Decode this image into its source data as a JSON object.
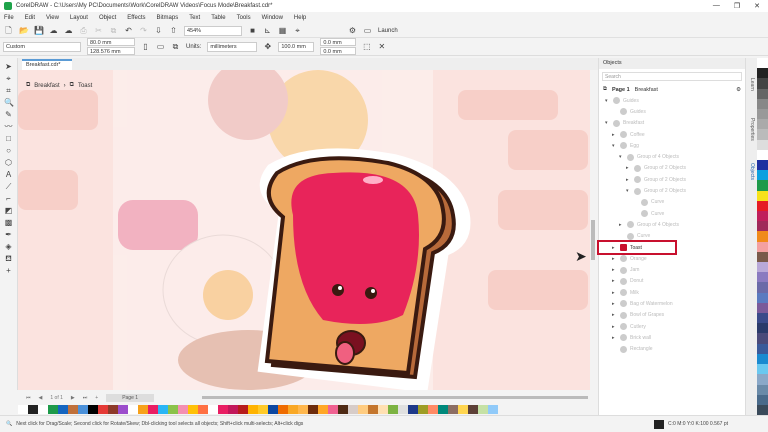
{
  "window": {
    "title": "CorelDRAW - C:\\Users\\My PC\\Documents\\Work\\CorelDRAW Videos\\Focus Mode\\Breakfast.cdr*",
    "controls": [
      "—",
      "❐",
      "✕"
    ]
  },
  "menu": [
    "File",
    "Edit",
    "View",
    "Layout",
    "Object",
    "Effects",
    "Bitmaps",
    "Text",
    "Table",
    "Tools",
    "Window",
    "Help"
  ],
  "toolbar": {
    "zoom": "454%",
    "launch": "Launch"
  },
  "propbar": {
    "page_size": "Custom",
    "width": "80.0 mm",
    "height": "128.576 mm",
    "units_label": "Units:",
    "units": "millimeters",
    "nudge": "100.0 mm",
    "dup_x": "0.0 mm",
    "dup_y": "0.0 mm"
  },
  "document_tab": "Breakfast.cdr*",
  "breadcrumb": [
    "Breakfast",
    "Toast"
  ],
  "page_nav": {
    "counter": "1 of 1",
    "page_tab": "Page 1"
  },
  "objects_panel": {
    "title": "Objects",
    "search_placeholder": "Search",
    "page": "Page 1",
    "layer": "Breakfast",
    "tree": [
      {
        "label": "Guides",
        "indent": 0,
        "arrow": "▾"
      },
      {
        "label": "Guides",
        "indent": 1,
        "arrow": ""
      },
      {
        "label": "Breakfast",
        "indent": 0,
        "arrow": "▾"
      },
      {
        "label": "Coffee",
        "indent": 1,
        "arrow": "▸"
      },
      {
        "label": "Egg",
        "indent": 1,
        "arrow": "▾"
      },
      {
        "label": "Group of 4 Objects",
        "indent": 2,
        "arrow": "▾"
      },
      {
        "label": "Group of 2 Objects",
        "indent": 3,
        "arrow": "▸"
      },
      {
        "label": "Group of 2 Objects",
        "indent": 3,
        "arrow": "▸"
      },
      {
        "label": "Group of 2 Objects",
        "indent": 3,
        "arrow": "▾"
      },
      {
        "label": "Curve",
        "indent": 4,
        "arrow": ""
      },
      {
        "label": "Curve",
        "indent": 4,
        "arrow": ""
      },
      {
        "label": "Group of 4 Objects",
        "indent": 2,
        "arrow": "▸"
      },
      {
        "label": "Curve",
        "indent": 2,
        "arrow": ""
      },
      {
        "label": "Toast",
        "indent": 1,
        "arrow": "▸",
        "highlight": true
      },
      {
        "label": "Orange",
        "indent": 1,
        "arrow": "▸"
      },
      {
        "label": "Jam",
        "indent": 1,
        "arrow": "▸"
      },
      {
        "label": "Donut",
        "indent": 1,
        "arrow": "▸"
      },
      {
        "label": "Milk",
        "indent": 1,
        "arrow": "▸"
      },
      {
        "label": "Bag of Watermelon",
        "indent": 1,
        "arrow": "▸"
      },
      {
        "label": "Bowl of Grapes",
        "indent": 1,
        "arrow": "▸"
      },
      {
        "label": "Cutlery",
        "indent": 1,
        "arrow": "▸"
      },
      {
        "label": "Brick wall",
        "indent": 1,
        "arrow": "▸"
      },
      {
        "label": "Rectangle",
        "indent": 1,
        "arrow": ""
      }
    ]
  },
  "dock_tabs": [
    "Learn",
    "Properties",
    "Objects"
  ],
  "status": {
    "hint": "Next click for Drag/Scale; Second click for Rotate/Skew; Dbl-clicking tool selects all objects; Shift+click multi-selects; Alt+click digs",
    "fill": "C:0 M:0 Y:0 K:100 0.567 pt"
  },
  "colors": {
    "accent": "#5b9bd5",
    "highlight": "#c8102e",
    "toast": "#e8a05a",
    "jam": "#e8245a"
  },
  "palette_h": [
    "#ffffff",
    "#222222",
    "#ffffff",
    "#1e9a4a",
    "#1565c0",
    "#c0703a",
    "#4a90d9",
    "#000000",
    "#e53935",
    "#8e3a2a",
    "#9c4dcc",
    "#ffffff",
    "#f7a11a",
    "#e91e63",
    "#29b6f6",
    "#8bc34a",
    "#f48fb1",
    "#ffc107",
    "#ff7043",
    "#ffffff",
    "#e91e63",
    "#c2185b",
    "#b71c1c",
    "#ffb300",
    "#ffca28",
    "#0d47a1",
    "#ef6c00",
    "#f9a825",
    "#ffb74d",
    "#6d2c0c",
    "#ffa726",
    "#f06292",
    "#4e2a14",
    "#d7ccc8",
    "#ffcc80",
    "#c4762d",
    "#ffe0b2",
    "#7cb342",
    "#e0e0e0",
    "#1e3a8a",
    "#9e9d24",
    "#ff8a65",
    "#00897b",
    "#8d6e63",
    "#ffd54f",
    "#5d4037",
    "#c5e1a5",
    "#90caf9"
  ],
  "palette_v": [
    "#ffffff",
    "#222",
    "#444",
    "#666",
    "#888",
    "#999",
    "#aaa",
    "#bbb",
    "#ddd",
    "#fff",
    "#1e2fa0",
    "#0aa0e0",
    "#1e9a4a",
    "#f7e21a",
    "#e51b24",
    "#c01f5b",
    "#a0295a",
    "#f08a1a",
    "#f4a0a0",
    "#7a5a4a",
    "#b8a8d8",
    "#8a7ac0",
    "#6a6aa8",
    "#5a7ac0",
    "#7a5a9a",
    "#3a4a8a",
    "#2a3a6a",
    "#4a4a7a",
    "#3a5a9a",
    "#1a8ad0",
    "#6ac8f0",
    "#8aa8c8",
    "#6a8aa8",
    "#4a6a8a",
    "#3a4a5a"
  ]
}
